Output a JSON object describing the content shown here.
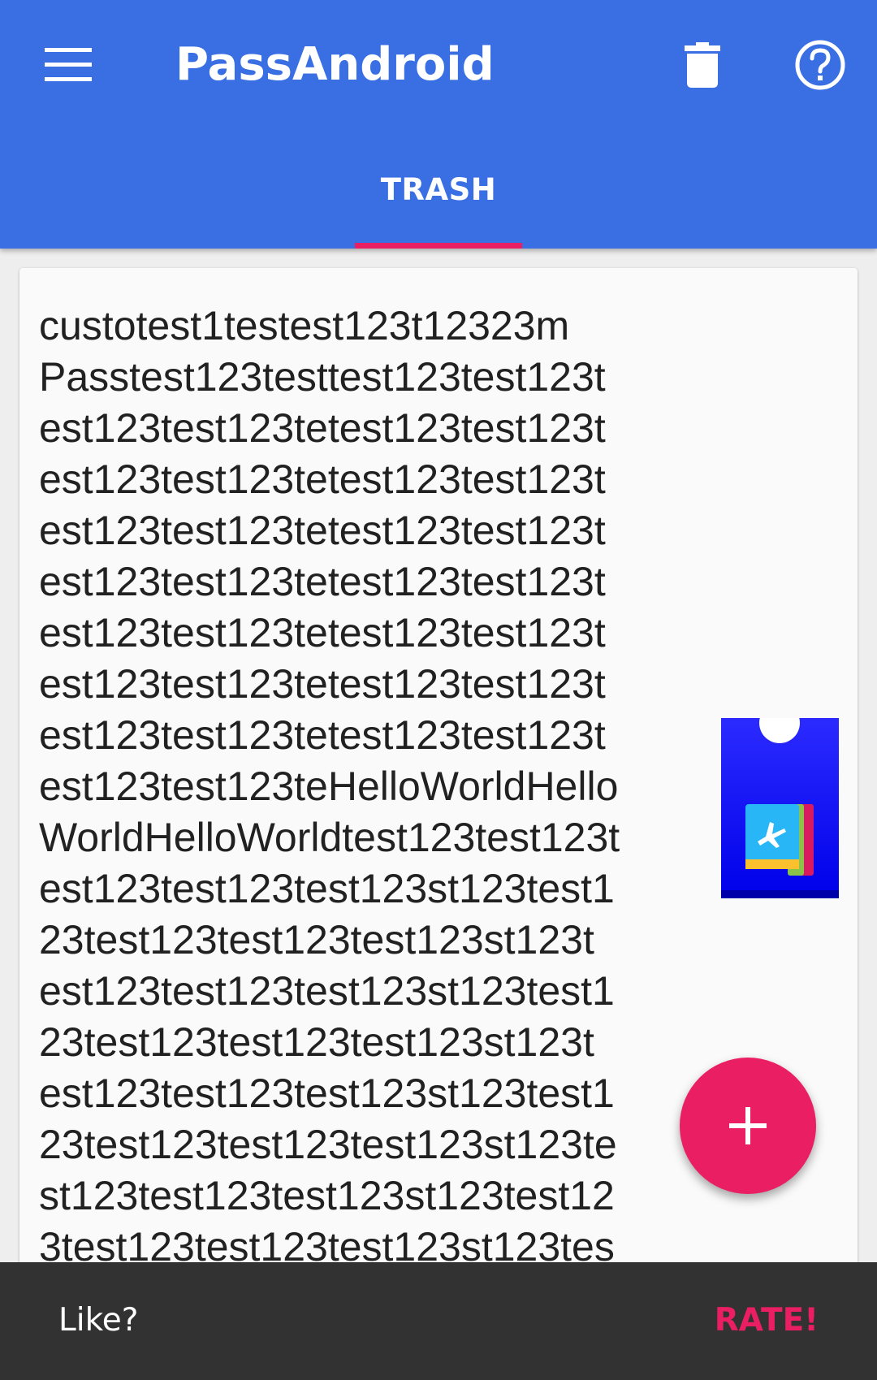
{
  "colors": {
    "primary": "#3a6fe4",
    "accent": "#e91e63",
    "snackbar": "#323232",
    "card": "#fafafa"
  },
  "toolbar": {
    "menu_icon": "hamburger-menu-icon",
    "title": "PassAndroid",
    "trash_icon": "trash-can-icon",
    "help_icon": "help-circle-icon"
  },
  "tabs": [
    {
      "label": "TRASH",
      "selected": true
    }
  ],
  "pass": {
    "lines": [
      "custotest1testest123t12323m",
      "Passtest123testtest123test123t",
      "est123test123tetest123test123t",
      "est123test123tetest123test123t",
      "est123test123tetest123test123t",
      "est123test123tetest123test123t",
      "est123test123tetest123test123t",
      "est123test123tetest123test123t",
      "est123test123tetest123test123t",
      "est123test123teHelloWorldHello",
      "WorldHelloWorldtest123test123t",
      "est123test123test123st123test1",
      "23test123test123test123st123t",
      "est123test123test123st123test1",
      "23test123test123test123st123t",
      "est123test123test123st123test1",
      "23test123test123test123st123te",
      "st123test123test123st123test12",
      "3test123test123test123st123tes"
    ],
    "thumbnail_icon": "boarding-pass-icon"
  },
  "fab": {
    "icon": "plus-icon"
  },
  "snackbar": {
    "message": "Like?",
    "action": "RATE!"
  }
}
